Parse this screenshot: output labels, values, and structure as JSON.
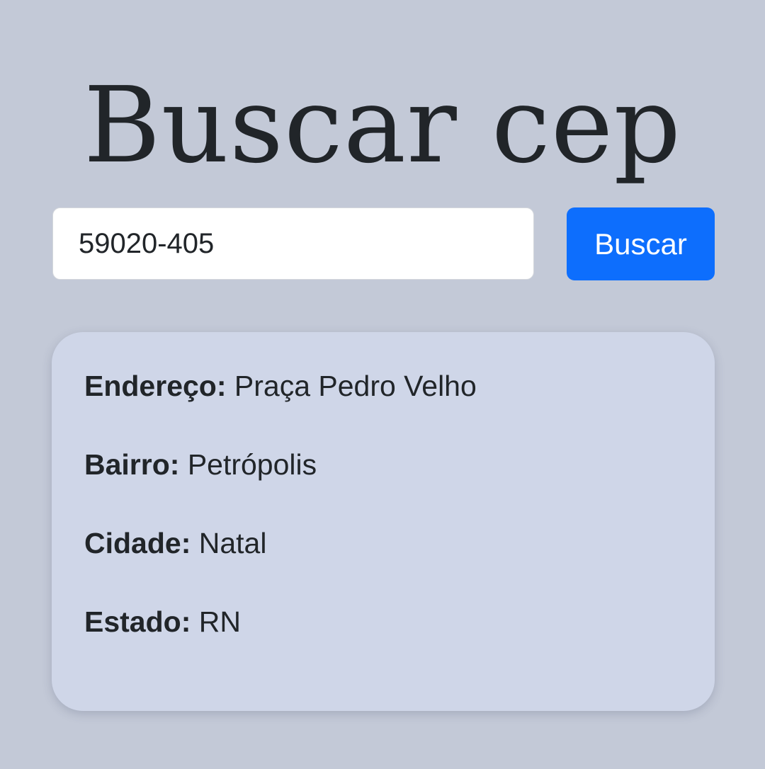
{
  "page": {
    "title": "Buscar cep"
  },
  "search": {
    "value": "59020-405",
    "button_label": "Buscar"
  },
  "result": {
    "rows": [
      {
        "label": "Endereço:",
        "value": "Praça Pedro Velho"
      },
      {
        "label": "Bairro:",
        "value": "Petrópolis"
      },
      {
        "label": "Cidade:",
        "value": "Natal"
      },
      {
        "label": "Estado:",
        "value": "RN"
      }
    ]
  },
  "colors": {
    "background": "#c3c9d7",
    "card": "#cfd6e8",
    "accent": "#0d6efd",
    "text": "#212529"
  }
}
